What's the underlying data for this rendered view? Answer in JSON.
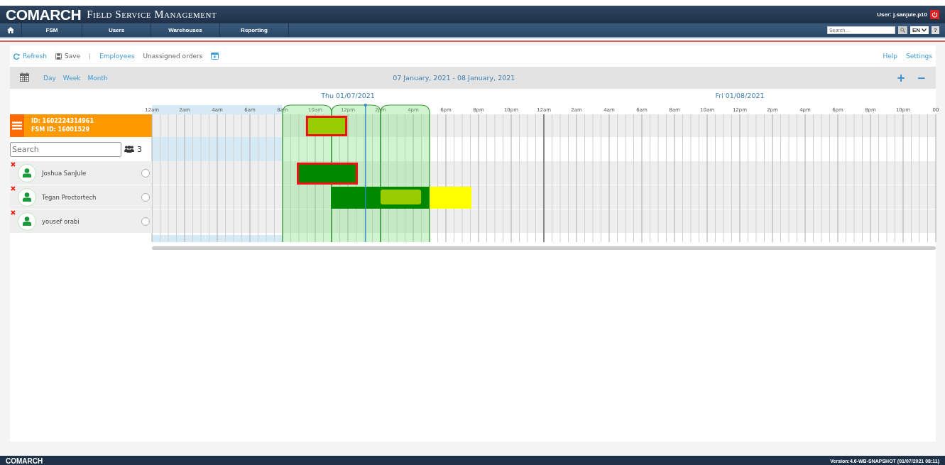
{
  "header": {
    "brand": "COMARCH",
    "title": "Field Service Management",
    "user": "User: j.sanjule.p10"
  },
  "nav": {
    "items": [
      "FSM",
      "Users",
      "Warehouses",
      "Reporting"
    ],
    "search": {
      "placeholder": "Search...."
    },
    "language": "EN",
    "help": "?"
  },
  "toolbar": {
    "refresh": "Refresh",
    "save": "Save",
    "separator": "|",
    "views": [
      {
        "label": "Employees",
        "selected": true
      },
      {
        "label": "Unassigned orders",
        "selected": false
      }
    ],
    "help": "Help",
    "settings": "Settings"
  },
  "period": {
    "modes": [
      "Day",
      "Week",
      "Month"
    ],
    "range": "07 January, 2021 - 08 January, 2021",
    "zoom_in": "+",
    "zoom_out": "−"
  },
  "gantt": {
    "days": [
      "Thu 01/07/2021",
      "Fri 01/08/2021"
    ],
    "hours": [
      "12am",
      "2am",
      "4am",
      "6am",
      "8am",
      "10am",
      "12pm",
      "2pm",
      "4pm",
      "6pm",
      "8pm",
      "10pm",
      "12am",
      "2am",
      "4am",
      "6am",
      "8am",
      "10am",
      "12pm",
      "2pm",
      "4pm",
      "6pm",
      "8pm",
      "10pm",
      "00"
    ],
    "order": {
      "id": "ID: 1602224314961",
      "fsm_id": "FSM ID: 16001529",
      "bars": [
        {
          "kind": "block",
          "color": "#99cc00",
          "outlined": true
        }
      ]
    },
    "search": {
      "placeholder": "Search"
    },
    "count": "3",
    "employees": [
      {
        "name": "Joshua SanJule",
        "selected": false,
        "bars": [
          {
            "kind": "block",
            "color": "#008800",
            "outlined": true
          }
        ]
      },
      {
        "name": "Tegan Proctortech",
        "selected": false,
        "bars": [
          {
            "kind": "block",
            "color": "#008800",
            "outlined": false
          },
          {
            "kind": "inset",
            "color": "#99cc00",
            "outlined": false
          },
          {
            "kind": "block",
            "color": "#ffff00",
            "outlined": false
          }
        ]
      },
      {
        "name": "yousef orabi",
        "selected": false
      }
    ]
  },
  "footer": {
    "brand": "COMARCH",
    "version": "Version:4.6-WB-SNAPSHOT (01/07/2021 08:11)"
  }
}
